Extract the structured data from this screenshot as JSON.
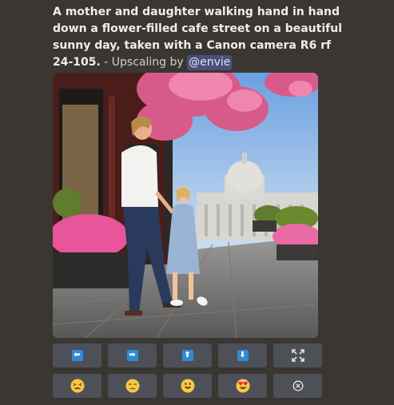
{
  "message": {
    "prompt_text": "A mother and daughter walking hand in hand down a flower-filled cafe street on a beautiful sunny day, taken with a Canon camera R6 rf 24-105.",
    "suffix_text": " - Upscaling by ",
    "mention": "@envie"
  },
  "buttons": {
    "row1": [
      {
        "name": "pan-left-button",
        "icon": "arrow-left-icon",
        "glyph": "⬅"
      },
      {
        "name": "pan-right-button",
        "icon": "arrow-right-icon",
        "glyph": "➡"
      },
      {
        "name": "pan-up-button",
        "icon": "arrow-up-icon",
        "glyph": "⬆"
      },
      {
        "name": "pan-down-button",
        "icon": "arrow-down-icon",
        "glyph": "⬇"
      },
      {
        "name": "expand-button",
        "icon": "expand-arrows-icon"
      }
    ],
    "row2": [
      {
        "name": "rate-tired-face-button",
        "icon": "tired-face-emoji-icon"
      },
      {
        "name": "rate-unamused-face-button",
        "icon": "unamused-face-emoji-icon"
      },
      {
        "name": "rate-smiley-face-button",
        "icon": "smiley-face-emoji-icon"
      },
      {
        "name": "rate-heart-eyes-button",
        "icon": "heart-eyes-emoji-icon"
      },
      {
        "name": "cancel-button",
        "icon": "cancel-circle-icon"
      }
    ]
  },
  "colors": {
    "background": "#3a3632",
    "button": "#4e5058",
    "arrow_blue": "#2f8bd8",
    "mention_bg": "#4a5077"
  }
}
